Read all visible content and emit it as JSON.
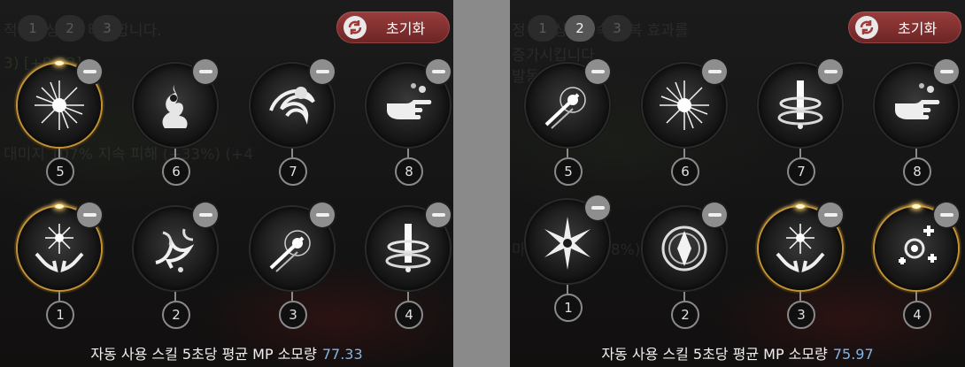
{
  "colors": {
    "gold": "#c29336",
    "mp_value": "#7fb6e6",
    "reset": "#8a3232"
  },
  "left": {
    "tabs": [
      "1",
      "2",
      "3"
    ],
    "active_tab": "1",
    "reset_label": "초기화",
    "slots": [
      {
        "num": "5",
        "icon": "radiant-burst-icon"
      },
      {
        "num": "6",
        "icon": "flame-spirit-icon"
      },
      {
        "num": "7",
        "icon": "spirit-vortex-icon"
      },
      {
        "num": "8",
        "icon": "pointing-hand-icon"
      },
      {
        "num": "1",
        "icon": "holy-hands-icon"
      },
      {
        "num": "2",
        "icon": "dark-dragon-icon"
      },
      {
        "num": "3",
        "icon": "piercing-strike-icon"
      },
      {
        "num": "4",
        "icon": "light-pillar-icon"
      }
    ],
    "footer_label": "자동 사용 스킬 5초당 평균 MP 소모량",
    "footer_value": "77.33"
  },
  "right": {
    "tabs": [
      "1",
      "2",
      "3"
    ],
    "active_tab": "2",
    "reset_label": "초기화",
    "slots": [
      {
        "num": "5",
        "icon": "piercing-strike-icon"
      },
      {
        "num": "6",
        "icon": "radiant-burst-icon"
      },
      {
        "num": "7",
        "icon": "light-pillar-icon"
      },
      {
        "num": "8",
        "icon": "pointing-hand-icon"
      },
      {
        "num": "1",
        "icon": "blade-star-icon"
      },
      {
        "num": "2",
        "icon": "crest-shield-icon"
      },
      {
        "num": "3",
        "icon": "holy-hands-icon"
      },
      {
        "num": "4",
        "icon": "healing-cross-icon"
      }
    ],
    "footer_label": "자동 사용 스킬 5초당 평균 MP 소모량",
    "footer_value": "75.97"
  }
}
